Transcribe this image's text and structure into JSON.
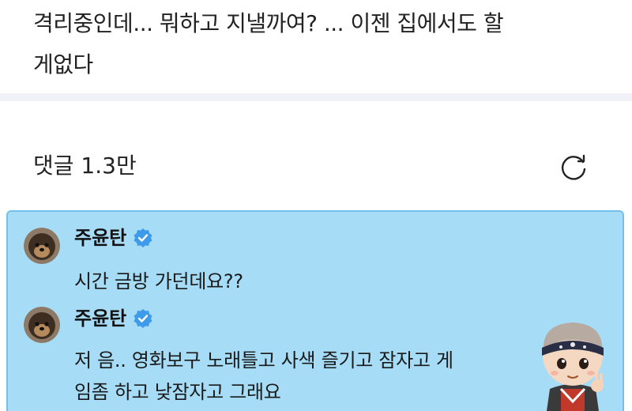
{
  "post": {
    "line1": "격리중인데... 뭐하고 지낼까여? ... 이젠 집에서도 할",
    "line2": "게없다"
  },
  "comments": {
    "header": "댓글 1.3만"
  },
  "reply_thread": {
    "items": [
      {
        "author": "주윤탄",
        "text": "시간 금방 가던데요??"
      },
      {
        "author": "주윤탄",
        "line1": "저 음.. 영화보구 노래틀고 사색 즐기고 잠자고 게",
        "line2": "임좀 하고 낮잠자고 그래요"
      }
    ]
  },
  "colors": {
    "highlight_bg": "#a7dcf7",
    "verified_badge": "#3d9be9",
    "divider": "#f0f2f7"
  },
  "icons": {
    "refresh": "refresh-icon",
    "verified": "verified-badge-icon"
  }
}
